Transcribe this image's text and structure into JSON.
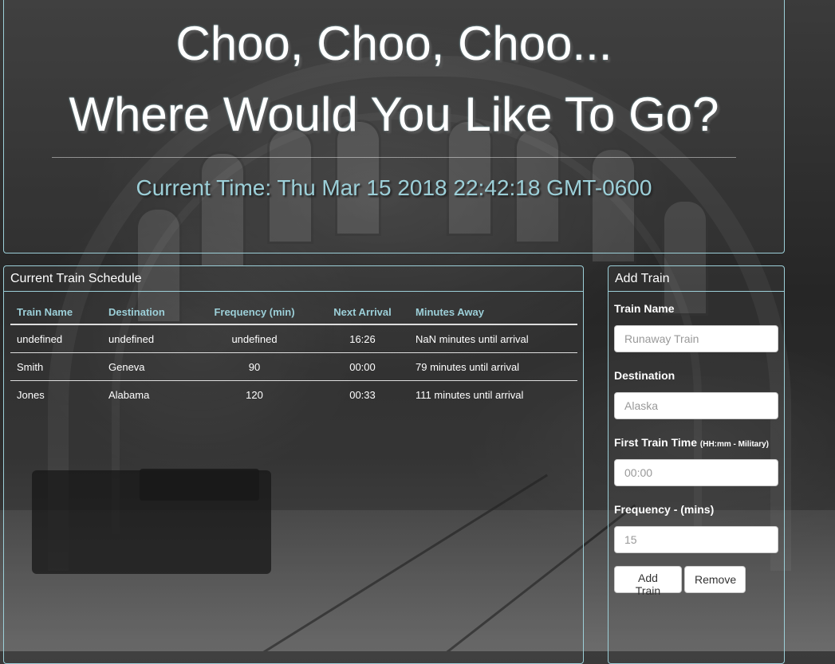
{
  "header": {
    "title_line1": "Choo, Choo, Choo...",
    "title_line2": "Where Would You Like To Go?",
    "current_time": "Current Time: Thu Mar 15 2018 22:42:18 GMT-0600"
  },
  "schedule": {
    "heading": "Current Train Schedule",
    "columns": [
      "Train Name",
      "Destination",
      "Frequency (min)",
      "Next Arrival",
      "Minutes Away"
    ],
    "rows": [
      [
        "undefined",
        "undefined",
        "undefined",
        "16:26",
        "NaN minutes until arrival"
      ],
      [
        "Smith",
        "Geneva",
        "90",
        "00:00",
        "79 minutes until arrival"
      ],
      [
        "Jones",
        "Alabama",
        "120",
        "00:33",
        "111 minutes until arrival"
      ]
    ]
  },
  "add_train": {
    "heading": "Add Train",
    "train_name_label": "Train Name",
    "train_name_placeholder": "Runaway Train",
    "destination_label": "Destination",
    "destination_placeholder": "Alaska",
    "first_time_label": "First Train Time",
    "first_time_hint": "(HH:mm - Military)",
    "first_time_placeholder": "00:00",
    "frequency_label": "Frequency - (mins)",
    "frequency_placeholder": "15",
    "add_button": "Add Train",
    "remove_button": "Remove"
  },
  "colors": {
    "accent": "#9ccfd8",
    "text": "#ffffff"
  }
}
